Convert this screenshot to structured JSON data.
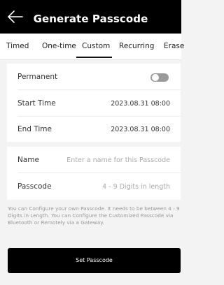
{
  "header": {
    "title": "Generate Passcode"
  },
  "tabs": [
    {
      "label": "Timed"
    },
    {
      "label": "One-time"
    },
    {
      "label": "Custom"
    },
    {
      "label": "Recurring"
    },
    {
      "label": "Erase"
    }
  ],
  "active_tab": "Custom",
  "settings": {
    "permanent_label": "Permanent",
    "permanent_on": false,
    "start_label": "Start Time",
    "start_value": "2023.08.31 08:00",
    "end_label": "End Time",
    "end_value": "2023.08.31 08:00"
  },
  "form": {
    "name_label": "Name",
    "name_placeholder": "Enter a name for this Passcode",
    "passcode_label": "Passcode",
    "passcode_placeholder": "4 - 9 Digits in length"
  },
  "note": "You can Configure your own Passcode. It needs to be between 4 - 9 Digits in Length. You can Configure the Customized Passcode via Bluetooth or Remotely via a Gateway.",
  "submit_label": "Set Passcode",
  "colors": {
    "header_bg": "#000000",
    "page_bg": "#f3f3f3",
    "button_bg": "#000000"
  }
}
